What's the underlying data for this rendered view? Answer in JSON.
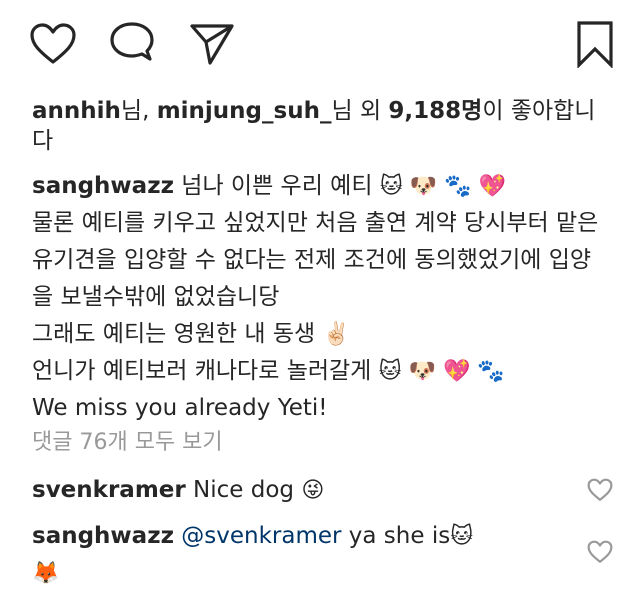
{
  "actions": {
    "like_icon": "heart-outline",
    "comment_icon": "speech-bubble",
    "share_icon": "paper-plane",
    "save_icon": "bookmark"
  },
  "likes": {
    "user1": "annhih",
    "sep1": "님, ",
    "user2": "minjung_suh_",
    "sep2": "님 외 ",
    "count": "9,188명",
    "tail": "이 좋아합니다"
  },
  "caption": {
    "username": "sanghwazz",
    "line1": " 넘나 이쁜 우리 예티 ",
    "line1_emoji": "🐱 🐶 🐾 💖",
    "line2": "물론 예티를 키우고 싶었지만 처음 출연 계약 당시부터 맡은 유기견을 입양할 수 없다는 전제 조건에 동의했었기에 입양을 보낼수밖에 없었습니당",
    "line3": "그래도 예티는 영원한 내 동생",
    "line3_emoji": "✌🏻",
    "line4": "언니가 예티보러 캐나다로 놀러갈게 ",
    "line4_emoji": "🐱 🐶 💖 🐾",
    "line5": "We miss you already Yeti!"
  },
  "view_all_comments": "댓글 76개 모두 보기",
  "comments": [
    {
      "username": "svenkramer",
      "text": " Nice dog ",
      "emoji": "😜"
    },
    {
      "username": "sanghwazz",
      "mention": "@svenkramer",
      "text": " ya she is",
      "emoji": "🐱",
      "emoji2": "🦊"
    }
  ]
}
